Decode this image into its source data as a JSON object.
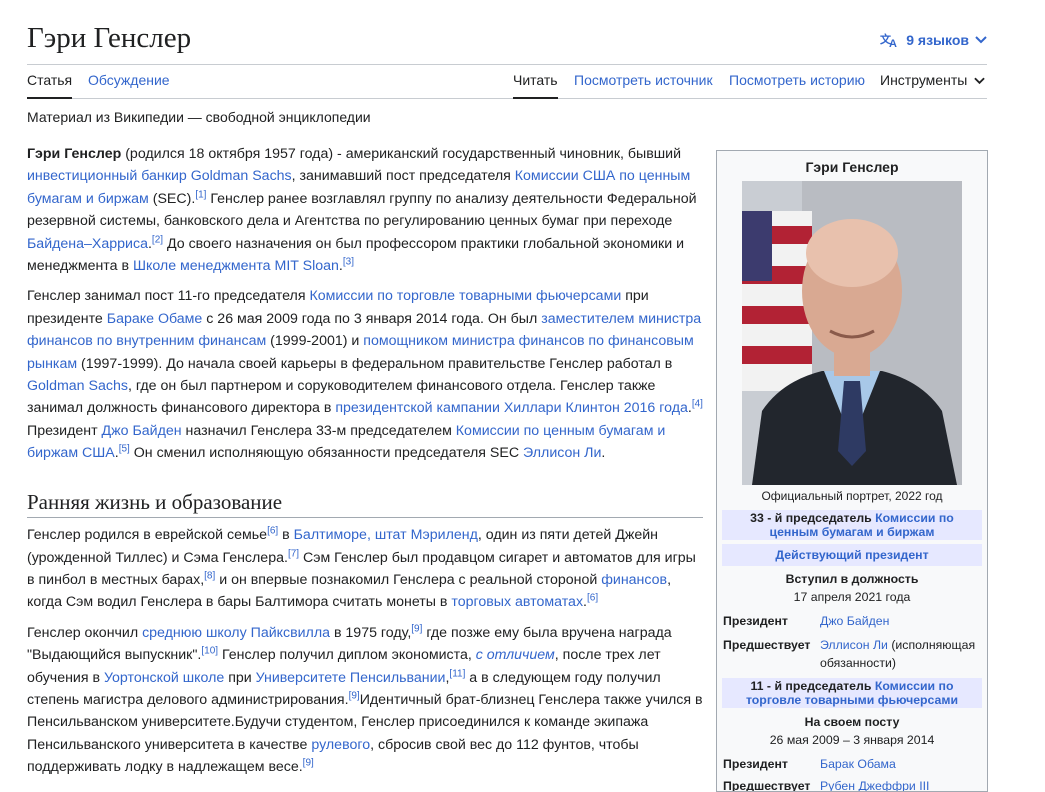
{
  "header": {
    "title": "Гэри Генслер",
    "languages_label": "9 языков"
  },
  "tabs": {
    "article": "Статья",
    "talk": "Обсуждение",
    "read": "Читать",
    "view_source": "Посмотреть источник",
    "view_history": "Посмотреть историю",
    "tools": "Инструменты"
  },
  "tagline": "Материал из Википедии — свободной энциклопедии",
  "article": {
    "p1": {
      "name": "Гэри Генслер",
      "t1": " (родился 18 октября 1957 года) - американский государственный чиновник, бывший ",
      "l1": "инвестиционный банкир Goldman Sachs",
      "t2": ", занимавший пост председателя ",
      "l2": "Комиссии США по ценным бумагам и биржам",
      "t3": " (SEC).",
      "r1": "[1]",
      "t4": " Генслер ранее возглавлял группу по анализу деятельности Федеральной резервной системы, банковского дела и Агентства по регулированию ценных бумаг при переходе ",
      "l3": "Байдена–Харриса",
      "t5": ".",
      "r2": "[2]",
      "t6": " До своего назначения он был профессором практики глобальной экономики и менеджмента в ",
      "l4": "Школе менеджмента MIT Sloan",
      "t7": ".",
      "r3": "[3]"
    },
    "p2": {
      "t1": "Генслер занимал пост 11-го председателя ",
      "l1": "Комиссии по торговле товарными фьючерсами",
      "t2": " при президенте ",
      "l2": "Бараке Обаме",
      "t3": " с 26 мая 2009 года по 3 января 2014 года. Он был ",
      "l3": "заместителем министра финансов по внутренним финансам",
      "t4": " (1999-2001) и ",
      "l4": "помощником министра финансов по финансовым рынкам",
      "t5": " (1997-1999). До начала своей карьеры в федеральном правительстве Генслер работал в ",
      "l5": "Goldman Sachs",
      "t6": ", где он был партнером и соруководителем финансового отдела. Генслер также занимал должность финансового директора в ",
      "l6": "президентской кампании Хиллари Клинтон 2016 года",
      "t7": ".",
      "r1": "[4]",
      "t8": " Президент ",
      "l7": "Джо Байден",
      "t9": " назначил Генслера 33-м председателем ",
      "l8": "Комиссии по ценным бумагам и биржам США",
      "t10": ".",
      "r2": "[5]",
      "t11": " Он сменил исполняющую обязанности председателя SEC ",
      "l9": "Эллисон Ли",
      "t12": "."
    },
    "h2": "Ранняя жизнь и образование",
    "p3": {
      "t1": "Генслер родился в еврейской семье",
      "r1": "[6]",
      "t2": " в ",
      "l1": "Балтиморе, штат Мэриленд",
      "t3": ", один из пяти детей Джейн (урожденной Тиллес) и Сэма Генслера.",
      "r2": "[7]",
      "t4": " Сэм Генслер был продавцом сигарет и автоматов для игры в пинбол в местных барах,",
      "r3": "[8]",
      "t5": " и он впервые познакомил Генслера с реальной стороной ",
      "l2": "финансов",
      "t6": ", когда Сэм водил Генслера в бары Балтимора считать монеты в ",
      "l3": "торговых автоматах",
      "t7": ".",
      "r4": "[6]"
    },
    "p4": {
      "t1": "Генслер окончил ",
      "l1": "среднюю школу Пайксвилла",
      "t2": " в 1975 году,",
      "r1": "[9]",
      "t3": " где позже ему была вручена награда \"Выдающийся выпускник\".",
      "r2": "[10]",
      "t4": " Генслер получил диплом экономиста, ",
      "l2": "с отличием",
      "t5": ", после трех лет обучения в ",
      "l3": "Уортонской школе",
      "t6": " при ",
      "l4": "Университете Пенсильвании",
      "t7": ",",
      "r3": "[11]",
      "t8": " а в следующем году получил степень магистра делового администрирования.",
      "r4": "[9]",
      "t9": "Идентичный брат-близнец Генслера также учился в Пенсильванском университете.Будучи студентом, Генслер присоединился к команде экипажа Пенсильванского университета в качестве ",
      "l5": "рулевого",
      "t10": ", сбросив свой вес до 112 фунтов, чтобы поддерживать лодку в надлежащем весе.",
      "r5": "[9]"
    }
  },
  "infobox": {
    "title": "Гэри Генслер",
    "caption": "Официальный портрет, 2022 год",
    "office1_prefix": "33 - й председатель ",
    "office1_link": "Комиссии по ценным бумагам и биржам",
    "incumbent": "Действующий президент",
    "assumed_label": "Вступил в должность",
    "assumed_date": "17 апреля 2021 года",
    "president_label": "Президент",
    "president1": "Джо Байден",
    "preceded_label": "Предшествует",
    "preceded1_link": "Эллисон Ли",
    "preceded1_text": " (исполняющая обязанности)",
    "office2_prefix": "11 - й председатель ",
    "office2_link": "Комиссии по торговле товарными фьючерсами",
    "in_office_label": "На своем посту",
    "in_office_dates": "26 мая 2009 – 3 января 2014",
    "president2": "Барак Обама",
    "preceded2_partial": "Рубен Джеффри III"
  },
  "colors": {
    "link": "#3366cc",
    "infobox_header": "#e6e8ff",
    "text": "#202122"
  }
}
